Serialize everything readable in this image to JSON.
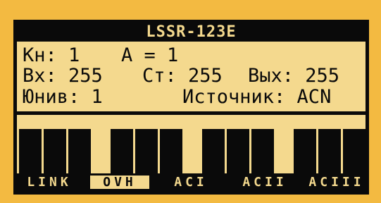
{
  "device": {
    "title": "LSSR-123E"
  },
  "info": {
    "kn_label": "Кн: 1",
    "a_label": "А = 1",
    "vx_label": "Вх: 255",
    "st_label": "Ст: 255",
    "vyx_label": "Вых: 255",
    "yuniv_label": "Юнив: 1",
    "source_label": "Источник: ACN"
  },
  "status": {
    "items": [
      {
        "label": "LINK",
        "active": false
      },
      {
        "label": "OVH",
        "active": true
      },
      {
        "label": "ACI",
        "active": false
      },
      {
        "label": "ACII",
        "active": false
      },
      {
        "label": "ACIII",
        "active": false
      }
    ]
  },
  "channel_bars": {
    "count": 12
  },
  "colors": {
    "background": "#F3BA41",
    "lcd": "#F4D98E",
    "ink": "#0a0a0a"
  }
}
